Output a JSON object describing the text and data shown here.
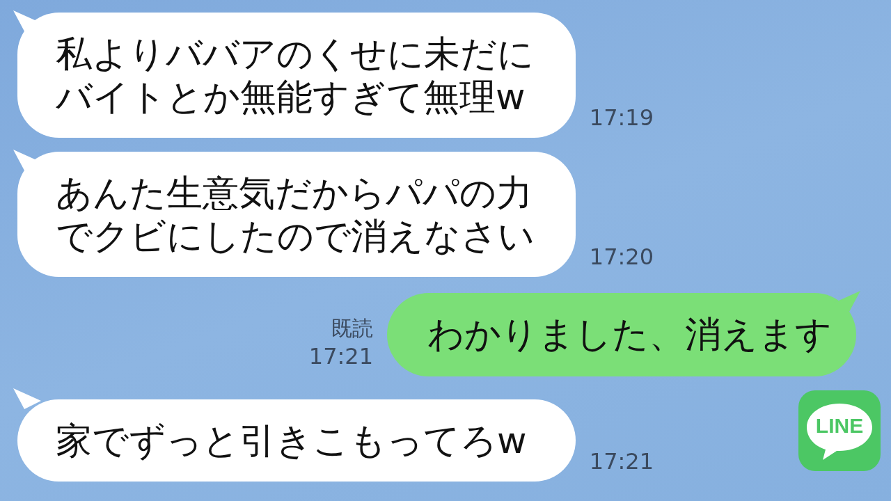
{
  "messages": [
    {
      "kind": "incoming",
      "text": "私よりババアのくせに未だにバイトとか無能すぎて無理w",
      "time": "17:19"
    },
    {
      "kind": "incoming",
      "text": "あんた生意気だからパパの力でクビにしたので消えなさい",
      "time": "17:20"
    },
    {
      "kind": "outgoing",
      "text": "わかりました、消えます",
      "read": "既読",
      "time": "17:21"
    },
    {
      "kind": "incoming",
      "text": "家でずっと引きこもってろw",
      "time": "17:21"
    }
  ],
  "logo": {
    "text": "LINE"
  }
}
